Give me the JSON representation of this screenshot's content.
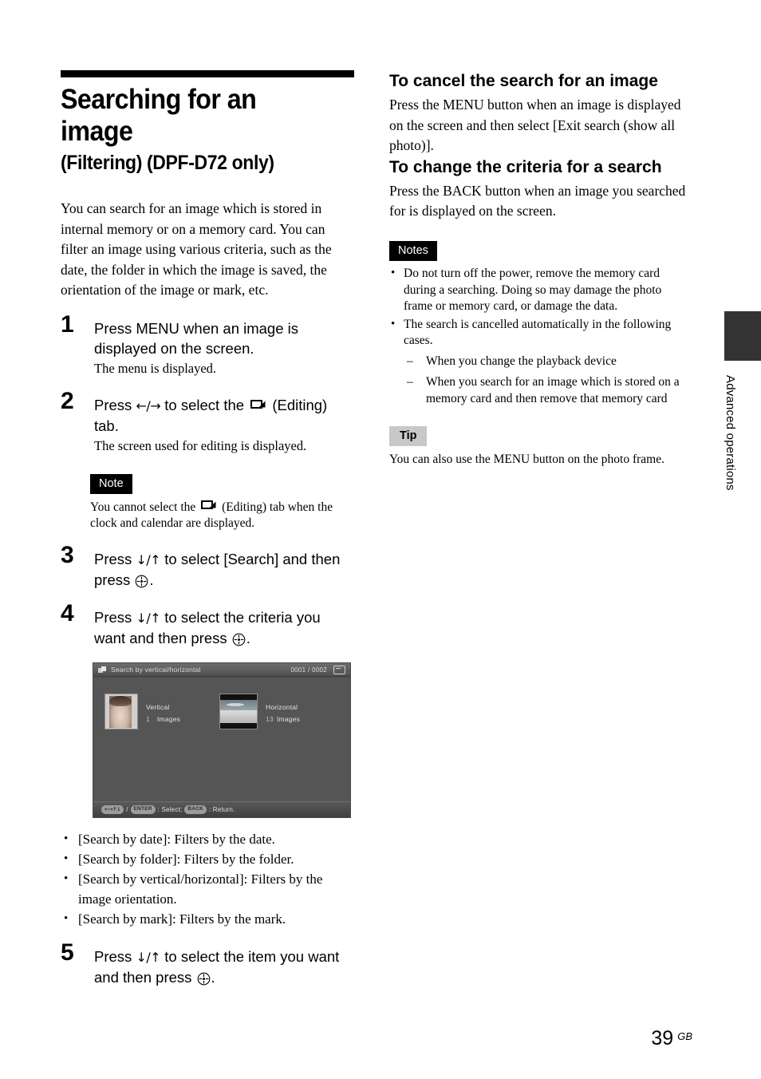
{
  "title": "Searching for an image",
  "subtitle": "(Filtering) (DPF-D72 only)",
  "intro": "You can search for an image which is stored in internal memory or on a memory card. You can filter an image using various criteria, such as the date, the folder in which the image is saved, the orientation of the image or mark, etc.",
  "steps": [
    {
      "number": "1",
      "main_before": "Press MENU when an image is displayed on the screen.",
      "sub": "The menu is displayed."
    },
    {
      "number": "2",
      "main_before": "Press ",
      "arrows": "←/→",
      "main_mid": " to select the ",
      "main_after": " (Editing) tab.",
      "sub": "The screen used for editing is displayed."
    },
    {
      "number": "3",
      "main_before": "Press ",
      "arrows": "↓/↑",
      "main_mid": " to select [Search] and then press ",
      "main_after": "."
    },
    {
      "number": "4",
      "main_before": "Press ",
      "arrows": "↓/↑",
      "main_mid": " to select the criteria you want and then press ",
      "main_after": "."
    },
    {
      "number": "5",
      "main_before": "Press ",
      "arrows": "↓/↑",
      "main_mid": " to select the item you want and then press ",
      "main_after": "."
    }
  ],
  "left_note": {
    "badge": "Note",
    "text_before": "You cannot select  the ",
    "text_after": " (Editing) tab when the clock and calendar are displayed."
  },
  "device_screenshot": {
    "title_icon": "folder-stack-icon",
    "title": "Search by vertical/horizontal",
    "counter": "0001 / 0002",
    "mode_icon": "display-mode-icon",
    "entries": [
      {
        "thumb": "portrait-photo-thumbnail",
        "label": "Vertical",
        "count": "1",
        "unit": "Images"
      },
      {
        "thumb": "landscape-photo-thumbnail",
        "label": "Horizontal",
        "count": "13",
        "unit": "Images"
      }
    ],
    "footer": {
      "dpad": "←→↑↓",
      "slash": "/",
      "enter_key": "ENTER",
      "select_text": ": Select;",
      "back_key": "BACK",
      "return_text": ": Return."
    }
  },
  "criteria_list": [
    "[Search by date]: Filters by the date.",
    "[Search by folder]: Filters by the folder.",
    "[Search by vertical/horizontal]: Filters by the image orientation.",
    "[Search by mark]: Filters by the mark."
  ],
  "right": {
    "section1": {
      "heading": "To cancel the search for an image",
      "body": "Press the MENU button when an image is displayed on the screen and then select [Exit search (show all photo)]."
    },
    "section2": {
      "heading": "To change the criteria for a search",
      "body": "Press the BACK button when an image you searched for is displayed on the screen."
    },
    "notes": {
      "badge": "Notes",
      "items": [
        "Do not turn off the power, remove the memory card during a searching. Doing so may damage the photo frame or memory card, or damage the data.",
        "The search is cancelled automatically in the following cases."
      ],
      "sub_items": [
        "When you change the playback device",
        "When you search for an image which is stored on a memory card and then remove that memory card"
      ]
    },
    "tip": {
      "badge": "Tip",
      "body": "You can also use the MENU button on the photo frame."
    }
  },
  "side_tab": {
    "label": "Advanced operations"
  },
  "footer": {
    "page_number": "39",
    "region": "GB"
  },
  "colors": {
    "badge_dark_bg": "#000000",
    "badge_gray_bg": "#c8c8c8",
    "side_tab_bg": "#333333",
    "device_bg": "#555555"
  }
}
